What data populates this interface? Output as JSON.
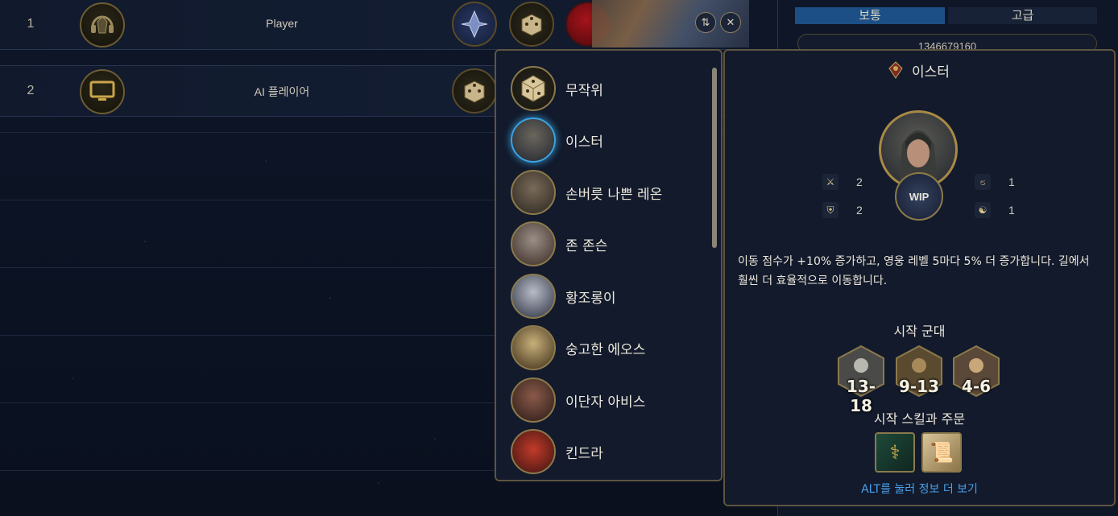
{
  "players": [
    {
      "num": "1",
      "name": "Player"
    },
    {
      "num": "2",
      "name": "AI 플레이어"
    }
  ],
  "difficulty": {
    "normal": "보통",
    "advanced": "고급"
  },
  "seed": "1346679160",
  "hero_list": [
    {
      "name": "무작위",
      "type": "dice"
    },
    {
      "name": "이스터",
      "selected": true
    },
    {
      "name": "손버릇 나쁜 레온"
    },
    {
      "name": "존 존슨"
    },
    {
      "name": "황조롱이"
    },
    {
      "name": "숭고한 에오스"
    },
    {
      "name": "이단자 아비스"
    },
    {
      "name": "킨드라"
    }
  ],
  "detail": {
    "title": "이스터",
    "badge": "WIP",
    "stats": {
      "attack": "2",
      "defense": "2",
      "spellpower": "1",
      "knowledge": "1"
    },
    "description": "이동 점수가 +10% 증가하고, 영웅 레벨 5마다 5% 더 증가합니다. 길에서 훨씬 더 효율적으로 이동합니다.",
    "army_title": "시작 군대",
    "army": [
      {
        "count": "13-18"
      },
      {
        "count": "9-13"
      },
      {
        "count": "4-6"
      }
    ],
    "skills_title": "시작 스킬과 주문",
    "alt_hint": "ALT를 눌러 정보 더 보기"
  },
  "colors": {
    "accent_blue": "#3aa4e0",
    "gold_border": "#8b7a4b",
    "player_red": "#a4141b",
    "link": "#4aa0e8"
  }
}
